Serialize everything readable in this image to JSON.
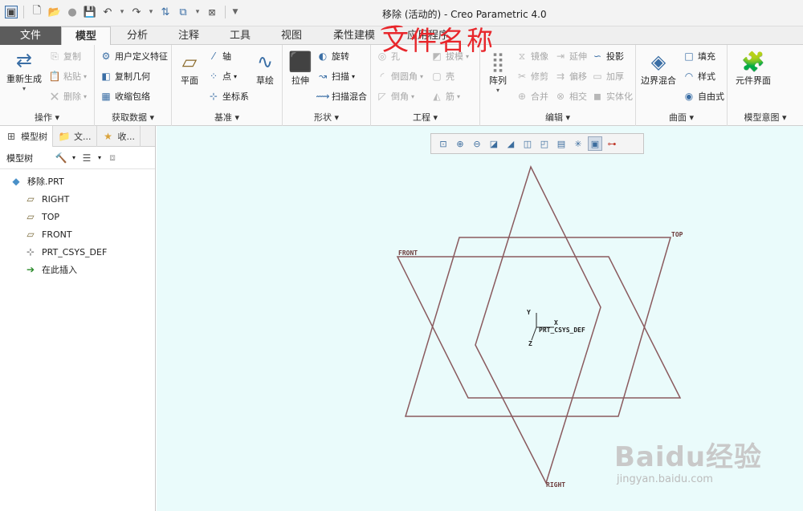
{
  "window": {
    "title": "移除 (活动的) - Creo Parametric 4.0",
    "annotation": "文件名称"
  },
  "tabs": [
    "文件",
    "模型",
    "分析",
    "注释",
    "工具",
    "视图",
    "柔性建模",
    "应用程序"
  ],
  "active_tab": "模型",
  "ribbon": {
    "operations": {
      "label": "操作",
      "regenerate": "重新生成",
      "copy": "复制",
      "paste": "粘贴",
      "delete": "删除"
    },
    "get_data": {
      "label": "获取数据",
      "udf": "用户定义特征",
      "copy_geom": "复制几何",
      "shrinkwrap": "收缩包络"
    },
    "datum": {
      "label": "基准",
      "plane": "平面",
      "axis": "轴",
      "point": "点",
      "csys": "坐标系",
      "sketch": "草绘"
    },
    "shapes": {
      "label": "形状",
      "extrude": "拉伸",
      "revolve": "旋转",
      "sweep": "扫描",
      "swept_blend": "扫描混合"
    },
    "engineering": {
      "label": "工程",
      "hole": "孔",
      "draft": "拔模",
      "round": "倒圆角",
      "shell": "壳",
      "chamfer": "倒角",
      "rib": "筋"
    },
    "editing": {
      "label": "编辑",
      "pattern": "阵列",
      "mirror": "镜像",
      "extend": "延伸",
      "project": "投影",
      "trim": "修剪",
      "offset": "偏移",
      "thicken": "加厚",
      "merge": "合并",
      "intersect": "相交",
      "solidify": "实体化"
    },
    "surfaces": {
      "label": "曲面",
      "boundary_blend": "边界混合",
      "fill": "填充",
      "style": "样式",
      "freestyle": "自由式"
    },
    "model_intent": {
      "label": "模型意图",
      "component_interface": "元件界面"
    }
  },
  "panel": {
    "tabs": [
      "模型树",
      "文...",
      "收..."
    ],
    "toolbar_label": "模型树",
    "items": [
      {
        "label": "移除.PRT",
        "icon": "part-icon"
      },
      {
        "label": "RIGHT",
        "icon": "datum-plane-icon"
      },
      {
        "label": "TOP",
        "icon": "datum-plane-icon"
      },
      {
        "label": "FRONT",
        "icon": "datum-plane-icon"
      },
      {
        "label": "PRT_CSYS_DEF",
        "icon": "csys-icon"
      },
      {
        "label": "在此插入",
        "icon": "insert-here-icon"
      }
    ]
  },
  "viewport": {
    "datum_labels": {
      "front": "FRONT",
      "top": "TOP",
      "right": "RIGHT"
    },
    "csys": {
      "name": "PRT_CSYS_DEF",
      "x": "X",
      "y": "Y",
      "z": "Z"
    }
  },
  "watermark": {
    "text": "Baidu经验",
    "url": "jingyan.baidu.com"
  },
  "colors": {
    "file_tab": "#5c5c5c",
    "viewport_bg": "#eafbfb",
    "datum_line": "#8a5a5e",
    "annotation": "#e8262b"
  }
}
